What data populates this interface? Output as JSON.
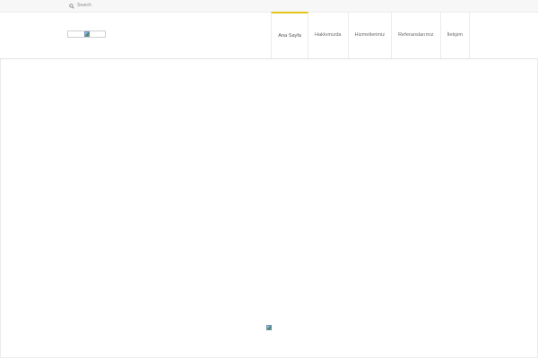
{
  "topbar": {
    "search_label": "Search"
  },
  "header": {
    "logo_icon": "broken-image-icon"
  },
  "nav": {
    "items": [
      {
        "label": "Ana Sayfa",
        "active": true
      },
      {
        "label": "Hakkımızda"
      },
      {
        "label": "Hizmetlerimiz"
      },
      {
        "label": "Referanslarımız"
      },
      {
        "label": "İletişim"
      }
    ]
  },
  "colors": {
    "accent": "#e0c419",
    "topbar_bg": "#f7f7f7",
    "border": "#ececec"
  },
  "content": {
    "image_icon": "broken-image-icon"
  }
}
